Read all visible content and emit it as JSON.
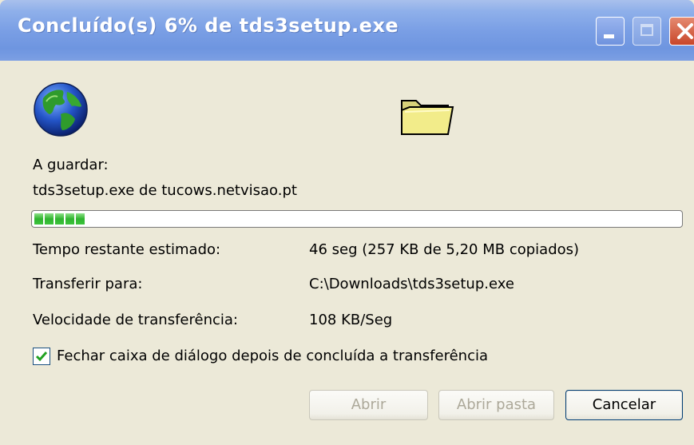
{
  "window": {
    "title": "Concluído(s) 6% de tds3setup.exe",
    "controls": [
      "minimize-icon",
      "maximize-icon",
      "close-icon"
    ]
  },
  "icons": {
    "source": "globe-icon",
    "destination": "folder-icon"
  },
  "download": {
    "saving_label": "A guardar:",
    "source_text": "tds3setup.exe de tucows.netvisao.pt",
    "progress_fraction": 0.06,
    "progress_chunks": 5
  },
  "details": {
    "time_label": "Tempo restante estimado:",
    "time_value": "46 seg (257 KB de 5,20 MB copiados)",
    "dest_label": "Transferir para:",
    "dest_value": "C:\\Downloads\\tds3setup.exe",
    "speed_label": "Velocidade de transferência:",
    "speed_value": "108 KB/Seg"
  },
  "options": {
    "close_on_complete_label": "Fechar caixa de diálogo depois de concluída a transferência",
    "close_on_complete_checked": true
  },
  "buttons": {
    "open": "Abrir",
    "open_folder": "Abrir pasta",
    "cancel": "Cancelar"
  },
  "colors": {
    "title_bar": "#7a9fe5",
    "dialog_bg": "#ece9d8",
    "progress_fill": "#2fb42f",
    "close_button": "#c8462a"
  }
}
